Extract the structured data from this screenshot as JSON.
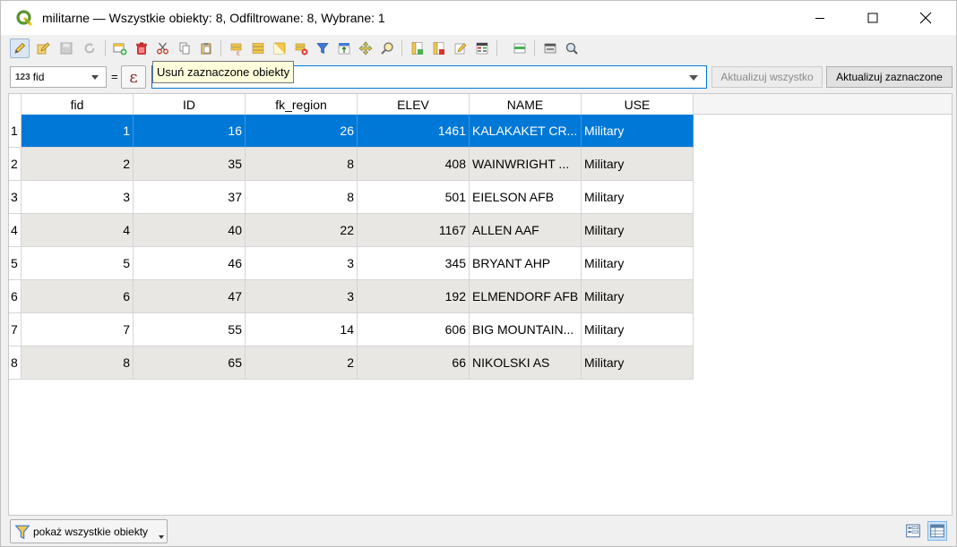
{
  "window": {
    "title": "militarne — Wszystkie obiekty: 8, Odfiltrowane: 8, Wybrane: 1"
  },
  "toolbar": {
    "buttons": [
      {
        "name": "toggle-editing-icon",
        "state": "active"
      },
      {
        "name": "toggle-multi-edit-icon"
      },
      {
        "name": "save-edits-icon",
        "state": "disabled"
      },
      {
        "name": "reload-table-icon",
        "state": "disabled"
      },
      {
        "name": "add-feature-icon"
      },
      {
        "name": "delete-selected-icon"
      },
      {
        "name": "cut-icon"
      },
      {
        "name": "copy-icon"
      },
      {
        "name": "paste-icon"
      },
      {
        "name": "select-by-expression-icon"
      },
      {
        "name": "select-all-icon"
      },
      {
        "name": "invert-selection-icon"
      },
      {
        "name": "deselect-all-icon"
      },
      {
        "name": "filter-select-icon"
      },
      {
        "name": "move-selection-top-icon"
      },
      {
        "name": "pan-to-selected-icon"
      },
      {
        "name": "zoom-to-selected-icon"
      },
      {
        "name": "new-field-icon"
      },
      {
        "name": "delete-field-icon"
      },
      {
        "name": "field-calculator-icon"
      },
      {
        "name": "conditional-formatting-icon"
      },
      {
        "name": "dock-table-icon"
      },
      {
        "name": "actions-icon"
      },
      {
        "name": "search-icon"
      }
    ],
    "tooltip": "Usuń zaznaczone obiekty"
  },
  "filter_bar": {
    "field_type": "123",
    "field_name": "fid",
    "operator": "=",
    "expression_symbol": "ε",
    "value": "",
    "update_all_label": "Aktualizuj wszystko",
    "update_selected_label": "Aktualizuj zaznaczone"
  },
  "table": {
    "columns": [
      "fid",
      "ID",
      "fk_region",
      "ELEV",
      "NAME",
      "USE"
    ],
    "rows": [
      {
        "n": "1",
        "fid": "1",
        "ID": "16",
        "fk_region": "26",
        "ELEV": "1461",
        "NAME": "KALAKAKET CR...",
        "USE": "Military",
        "selected": true
      },
      {
        "n": "2",
        "fid": "2",
        "ID": "35",
        "fk_region": "8",
        "ELEV": "408",
        "NAME": "WAINWRIGHT ...",
        "USE": "Military"
      },
      {
        "n": "3",
        "fid": "3",
        "ID": "37",
        "fk_region": "8",
        "ELEV": "501",
        "NAME": "EIELSON AFB",
        "USE": "Military"
      },
      {
        "n": "4",
        "fid": "4",
        "ID": "40",
        "fk_region": "22",
        "ELEV": "1167",
        "NAME": "ALLEN AAF",
        "USE": "Military"
      },
      {
        "n": "5",
        "fid": "5",
        "ID": "46",
        "fk_region": "3",
        "ELEV": "345",
        "NAME": "BRYANT AHP",
        "USE": "Military"
      },
      {
        "n": "6",
        "fid": "6",
        "ID": "47",
        "fk_region": "3",
        "ELEV": "192",
        "NAME": "ELMENDORF AFB",
        "USE": "Military"
      },
      {
        "n": "7",
        "fid": "7",
        "ID": "55",
        "fk_region": "14",
        "ELEV": "606",
        "NAME": "BIG MOUNTAIN...",
        "USE": "Military"
      },
      {
        "n": "8",
        "fid": "8",
        "ID": "65",
        "fk_region": "2",
        "ELEV": "66",
        "NAME": "NIKOLSKI AS",
        "USE": "Military"
      }
    ]
  },
  "bottom_bar": {
    "filter_label": "pokaż wszystkie obiekty"
  },
  "colors": {
    "selection": "#0078d7",
    "alt_row": "#e9e7e3",
    "qgis_green": "#589632"
  }
}
